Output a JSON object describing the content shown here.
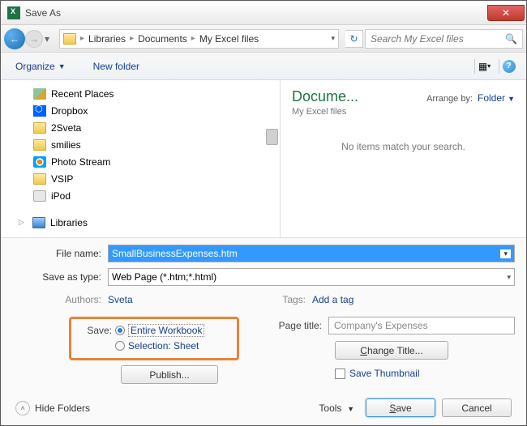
{
  "window": {
    "title": "Save As"
  },
  "breadcrumb": {
    "root": "Libraries",
    "mid": "Documents",
    "leaf": "My Excel files"
  },
  "search": {
    "placeholder": "Search My Excel files"
  },
  "toolbar": {
    "organize": "Organize",
    "newfolder": "New folder"
  },
  "tree": {
    "items": [
      {
        "label": "Recent Places",
        "iconClass": "recent-ic"
      },
      {
        "label": "Dropbox",
        "iconClass": "dropbox-ic"
      },
      {
        "label": "2Sveta",
        "iconClass": "folder-ic"
      },
      {
        "label": "smilies",
        "iconClass": "folder-ic"
      },
      {
        "label": "Photo Stream",
        "iconClass": "photo-ic"
      },
      {
        "label": "VSIP",
        "iconClass": "folder-ic"
      },
      {
        "label": "iPod",
        "iconClass": "ipod-ic"
      }
    ],
    "libraries": "Libraries"
  },
  "preview": {
    "title": "Docume...",
    "subtitle": "My Excel files",
    "arrange_label": "Arrange by:",
    "arrange_value": "Folder",
    "empty_msg": "No items match your search."
  },
  "form": {
    "filename_label": "File name:",
    "filename_value": "SmallBusinessExpenses.htm",
    "saveastype_label": "Save as type:",
    "saveastype_value": "Web Page (*.htm;*.html)",
    "authors_label": "Authors:",
    "authors_value": "Sveta",
    "tags_label": "Tags:",
    "tags_value": "Add a tag"
  },
  "save_opts": {
    "label": "Save:",
    "entire": "Entire Workbook",
    "selection": "Selection: Sheet",
    "publish": "Publish..."
  },
  "page_title": {
    "label": "Page title:",
    "value": "Company's Expenses",
    "change": "Change Title...",
    "thumb": "Save Thumbnail"
  },
  "bottom": {
    "hide_folders": "Hide Folders",
    "tools": "Tools",
    "save": "Save",
    "cancel": "Cancel"
  }
}
